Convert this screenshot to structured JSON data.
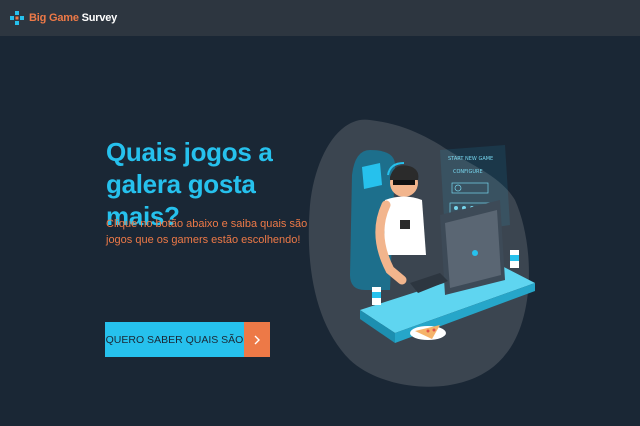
{
  "header": {
    "brand_part1": "Big Game",
    "brand_part2": " Survey",
    "logo_icon": "gamepad-cross-icon"
  },
  "hero": {
    "headline": "Quais jogos a\ngalera gosta mais?",
    "subtitle": "Clique no botão abaixo e saiba quais são os jogos que os gamers estão escolhendo!",
    "cta_label": "Quero saber quais são",
    "cta_icon": "chevron-right-icon"
  },
  "illustration": {
    "screen_label_1": "START NEW GAME",
    "screen_label_2": "CONFIGURE"
  },
  "colors": {
    "background": "#1a2735",
    "header": "#2d3640",
    "primary": "#26c1ed",
    "accent": "#ed7947"
  }
}
